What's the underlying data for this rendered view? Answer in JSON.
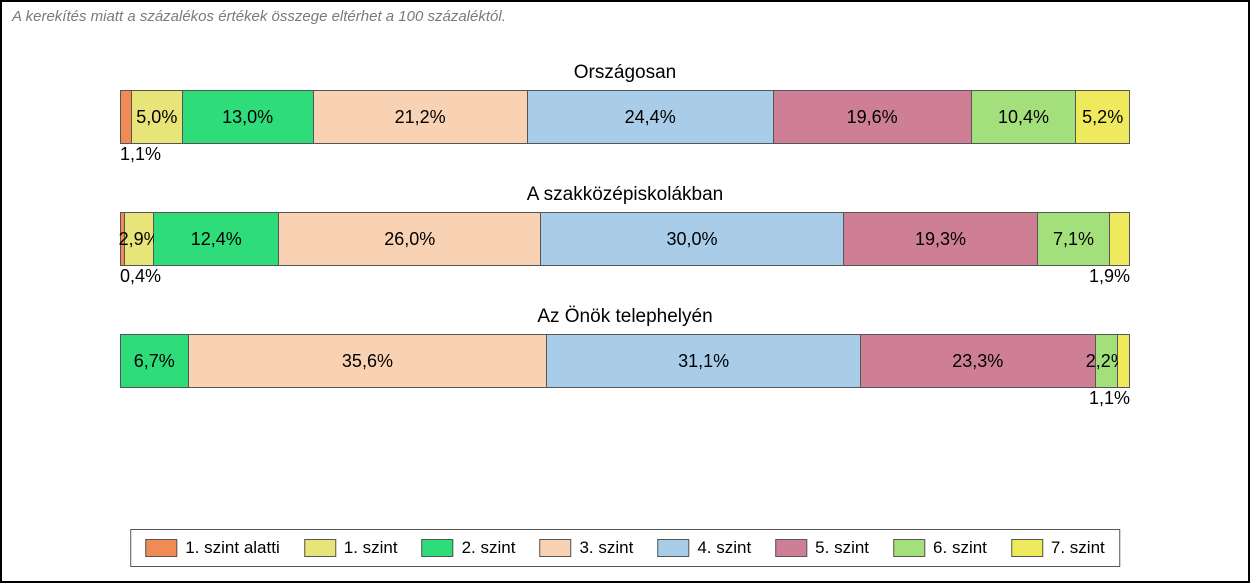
{
  "note": "A kerekítés miatt a százalékos értékek összege eltérhet a 100 százaléktól.",
  "legend": [
    {
      "label": "1. szint alatti",
      "cls": "c0"
    },
    {
      "label": "1. szint",
      "cls": "c1"
    },
    {
      "label": "2. szint",
      "cls": "c2"
    },
    {
      "label": "3. szint",
      "cls": "c3"
    },
    {
      "label": "4. szint",
      "cls": "c4"
    },
    {
      "label": "5. szint",
      "cls": "c5"
    },
    {
      "label": "6. szint",
      "cls": "c6"
    },
    {
      "label": "7. szint",
      "cls": "c7"
    }
  ],
  "rows": [
    {
      "title": "Országosan",
      "below_left": "1,1%",
      "below_right": "",
      "segs": [
        {
          "cls": "c0",
          "pct": 1.1,
          "label": "",
          "show": false
        },
        {
          "cls": "c1",
          "pct": 5.0,
          "label": "5,0%",
          "show": true
        },
        {
          "cls": "c2",
          "pct": 13.0,
          "label": "13,0%",
          "show": true
        },
        {
          "cls": "c3",
          "pct": 21.2,
          "label": "21,2%",
          "show": true
        },
        {
          "cls": "c4",
          "pct": 24.4,
          "label": "24,4%",
          "show": true
        },
        {
          "cls": "c5",
          "pct": 19.6,
          "label": "19,6%",
          "show": true
        },
        {
          "cls": "c6",
          "pct": 10.4,
          "label": "10,4%",
          "show": true
        },
        {
          "cls": "c7",
          "pct": 5.2,
          "label": "5,2%",
          "show": true
        }
      ]
    },
    {
      "title": "A szakközépiskolákban",
      "below_left": "0,4%",
      "below_right": "1,9%",
      "segs": [
        {
          "cls": "c0",
          "pct": 0.4,
          "label": "",
          "show": false
        },
        {
          "cls": "c1",
          "pct": 2.9,
          "label": "2,9%",
          "show": true
        },
        {
          "cls": "c2",
          "pct": 12.4,
          "label": "12,4%",
          "show": true
        },
        {
          "cls": "c3",
          "pct": 26.0,
          "label": "26,0%",
          "show": true
        },
        {
          "cls": "c4",
          "pct": 30.0,
          "label": "30,0%",
          "show": true
        },
        {
          "cls": "c5",
          "pct": 19.3,
          "label": "19,3%",
          "show": true
        },
        {
          "cls": "c6",
          "pct": 7.1,
          "label": "7,1%",
          "show": true
        },
        {
          "cls": "c7",
          "pct": 1.9,
          "label": "",
          "show": false
        }
      ]
    },
    {
      "title": "Az Önök telephelyén",
      "below_left": "",
      "below_right": "1,1%",
      "segs": [
        {
          "cls": "c0",
          "pct": 0.0,
          "label": "",
          "show": false
        },
        {
          "cls": "c1",
          "pct": 0.0,
          "label": "",
          "show": false
        },
        {
          "cls": "c2",
          "pct": 6.7,
          "label": "6,7%",
          "show": true
        },
        {
          "cls": "c3",
          "pct": 35.6,
          "label": "35,6%",
          "show": true
        },
        {
          "cls": "c4",
          "pct": 31.1,
          "label": "31,1%",
          "show": true
        },
        {
          "cls": "c5",
          "pct": 23.3,
          "label": "23,3%",
          "show": true
        },
        {
          "cls": "c6",
          "pct": 2.2,
          "label": "2,2%",
          "show": true
        },
        {
          "cls": "c7",
          "pct": 1.1,
          "label": "",
          "show": false
        }
      ]
    }
  ],
  "chart_data": {
    "type": "bar",
    "stacked": true,
    "orientation": "horizontal",
    "unit": "percent",
    "categories": [
      "Országosan",
      "A szakközépiskolákban",
      "Az Önök telephelyén"
    ],
    "series": [
      {
        "name": "1. szint alatti",
        "values": [
          1.1,
          0.4,
          0.0
        ]
      },
      {
        "name": "1. szint",
        "values": [
          5.0,
          2.9,
          0.0
        ]
      },
      {
        "name": "2. szint",
        "values": [
          13.0,
          12.4,
          6.7
        ]
      },
      {
        "name": "3. szint",
        "values": [
          21.2,
          26.0,
          35.6
        ]
      },
      {
        "name": "4. szint",
        "values": [
          24.4,
          30.0,
          31.1
        ]
      },
      {
        "name": "5. szint",
        "values": [
          19.6,
          19.3,
          23.3
        ]
      },
      {
        "name": "6. szint",
        "values": [
          10.4,
          7.1,
          2.2
        ]
      },
      {
        "name": "7. szint",
        "values": [
          5.2,
          1.9,
          1.1
        ]
      }
    ],
    "title": "",
    "xlabel": "",
    "ylabel": ""
  }
}
